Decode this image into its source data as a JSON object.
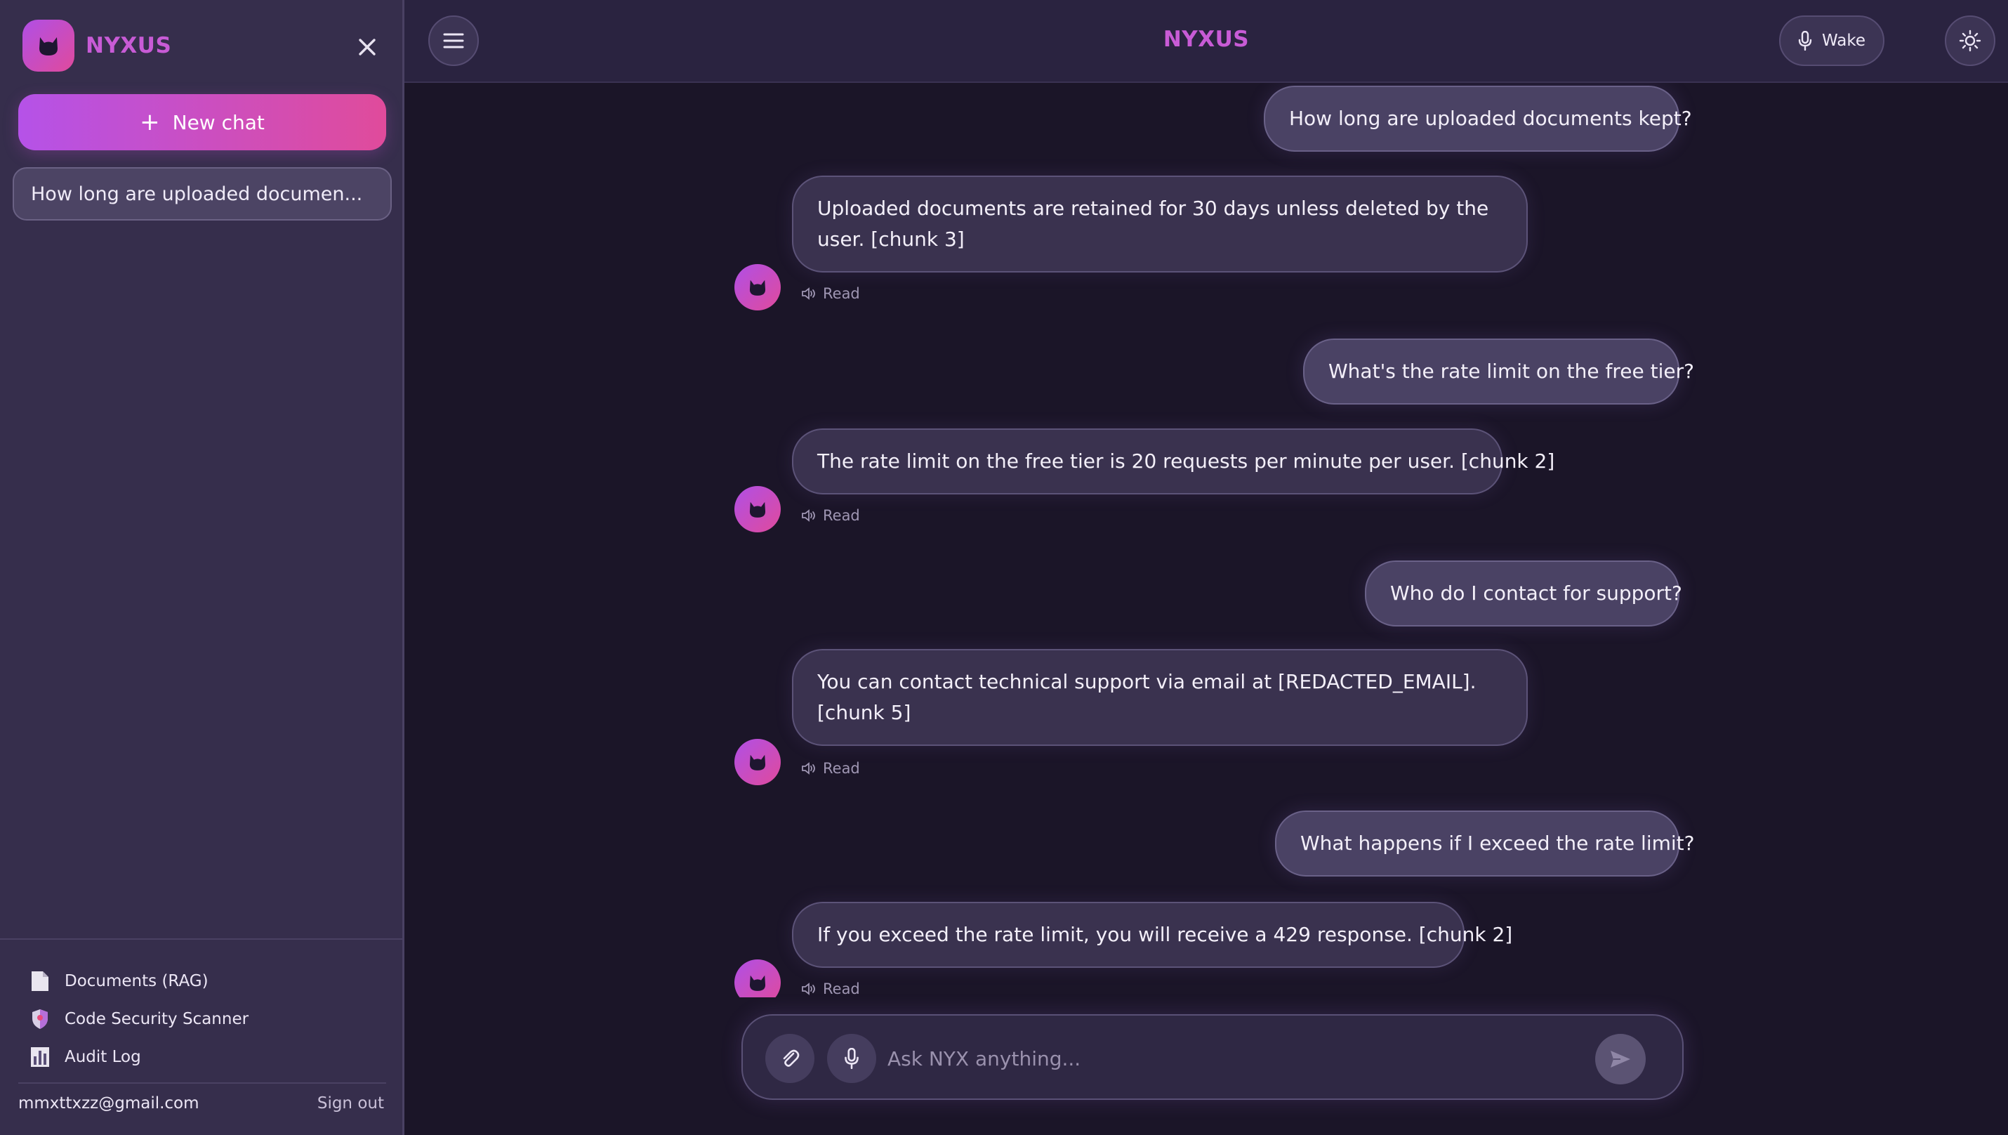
{
  "brand": {
    "name": "NYXUS"
  },
  "sidebar": {
    "new_chat_label": "New chat",
    "history": [
      {
        "title": "How long are uploaded documen..."
      }
    ],
    "nav": [
      {
        "label": "Documents (RAG)",
        "icon": "document-icon"
      },
      {
        "label": "Code Security Scanner",
        "icon": "shield-icon"
      },
      {
        "label": "Audit Log",
        "icon": "bar-chart-icon"
      }
    ],
    "user_email": "mmxttxzz@gmail.com",
    "sign_out_label": "Sign out"
  },
  "header": {
    "title": "NYXUS",
    "wake_label": "Wake"
  },
  "messages": [
    {
      "role": "user",
      "text": "How long are uploaded documents kept?"
    },
    {
      "role": "assistant",
      "text": "Uploaded documents are retained for 30 days unless deleted by the user. [chunk 3]",
      "read_label": "Read"
    },
    {
      "role": "user",
      "text": "What's the rate limit on the free tier?"
    },
    {
      "role": "assistant",
      "text": "The rate limit on the free tier is 20 requests per minute per user. [chunk 2]",
      "read_label": "Read"
    },
    {
      "role": "user",
      "text": "Who do I contact for support?"
    },
    {
      "role": "assistant",
      "text": "You can contact technical support via email at [REDACTED_EMAIL]. [chunk 5]",
      "read_label": "Read"
    },
    {
      "role": "user",
      "text": "What happens if I exceed the rate limit?"
    },
    {
      "role": "assistant",
      "text": "If you exceed the rate limit, you will receive a 429 response. [chunk 2]",
      "read_label": "Read"
    }
  ],
  "composer": {
    "placeholder": "Ask NYX anything..."
  },
  "colors": {
    "accent_start": "#b552e8",
    "accent_end": "#e04b9b",
    "brand_text": "#c85bd6",
    "background": "#1b1528",
    "sidebar": "#362e4c"
  }
}
